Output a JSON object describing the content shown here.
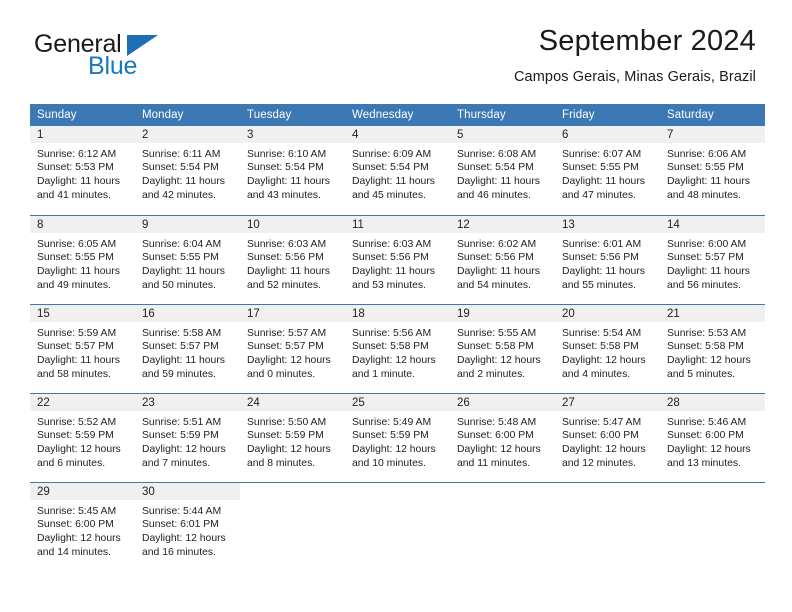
{
  "brand": {
    "name_part1": "General",
    "name_part2": "Blue",
    "color_dark": "#1a1a1a",
    "color_blue": "#1878be"
  },
  "header": {
    "title": "September 2024",
    "subtitle": "Campos Gerais, Minas Gerais, Brazil"
  },
  "theme": {
    "header_blue": "#3c78b4",
    "daynum_gray": "#f0f0f0",
    "text": "#222222"
  },
  "calendar": {
    "weekday_headers": [
      "Sunday",
      "Monday",
      "Tuesday",
      "Wednesday",
      "Thursday",
      "Friday",
      "Saturday"
    ],
    "weeks": [
      [
        {
          "day": "1",
          "sunrise": "Sunrise: 6:12 AM",
          "sunset": "Sunset: 5:53 PM",
          "daylight_line1": "Daylight: 11 hours",
          "daylight_line2": "and 41 minutes."
        },
        {
          "day": "2",
          "sunrise": "Sunrise: 6:11 AM",
          "sunset": "Sunset: 5:54 PM",
          "daylight_line1": "Daylight: 11 hours",
          "daylight_line2": "and 42 minutes."
        },
        {
          "day": "3",
          "sunrise": "Sunrise: 6:10 AM",
          "sunset": "Sunset: 5:54 PM",
          "daylight_line1": "Daylight: 11 hours",
          "daylight_line2": "and 43 minutes."
        },
        {
          "day": "4",
          "sunrise": "Sunrise: 6:09 AM",
          "sunset": "Sunset: 5:54 PM",
          "daylight_line1": "Daylight: 11 hours",
          "daylight_line2": "and 45 minutes."
        },
        {
          "day": "5",
          "sunrise": "Sunrise: 6:08 AM",
          "sunset": "Sunset: 5:54 PM",
          "daylight_line1": "Daylight: 11 hours",
          "daylight_line2": "and 46 minutes."
        },
        {
          "day": "6",
          "sunrise": "Sunrise: 6:07 AM",
          "sunset": "Sunset: 5:55 PM",
          "daylight_line1": "Daylight: 11 hours",
          "daylight_line2": "and 47 minutes."
        },
        {
          "day": "7",
          "sunrise": "Sunrise: 6:06 AM",
          "sunset": "Sunset: 5:55 PM",
          "daylight_line1": "Daylight: 11 hours",
          "daylight_line2": "and 48 minutes."
        }
      ],
      [
        {
          "day": "8",
          "sunrise": "Sunrise: 6:05 AM",
          "sunset": "Sunset: 5:55 PM",
          "daylight_line1": "Daylight: 11 hours",
          "daylight_line2": "and 49 minutes."
        },
        {
          "day": "9",
          "sunrise": "Sunrise: 6:04 AM",
          "sunset": "Sunset: 5:55 PM",
          "daylight_line1": "Daylight: 11 hours",
          "daylight_line2": "and 50 minutes."
        },
        {
          "day": "10",
          "sunrise": "Sunrise: 6:03 AM",
          "sunset": "Sunset: 5:56 PM",
          "daylight_line1": "Daylight: 11 hours",
          "daylight_line2": "and 52 minutes."
        },
        {
          "day": "11",
          "sunrise": "Sunrise: 6:03 AM",
          "sunset": "Sunset: 5:56 PM",
          "daylight_line1": "Daylight: 11 hours",
          "daylight_line2": "and 53 minutes."
        },
        {
          "day": "12",
          "sunrise": "Sunrise: 6:02 AM",
          "sunset": "Sunset: 5:56 PM",
          "daylight_line1": "Daylight: 11 hours",
          "daylight_line2": "and 54 minutes."
        },
        {
          "day": "13",
          "sunrise": "Sunrise: 6:01 AM",
          "sunset": "Sunset: 5:56 PM",
          "daylight_line1": "Daylight: 11 hours",
          "daylight_line2": "and 55 minutes."
        },
        {
          "day": "14",
          "sunrise": "Sunrise: 6:00 AM",
          "sunset": "Sunset: 5:57 PM",
          "daylight_line1": "Daylight: 11 hours",
          "daylight_line2": "and 56 minutes."
        }
      ],
      [
        {
          "day": "15",
          "sunrise": "Sunrise: 5:59 AM",
          "sunset": "Sunset: 5:57 PM",
          "daylight_line1": "Daylight: 11 hours",
          "daylight_line2": "and 58 minutes."
        },
        {
          "day": "16",
          "sunrise": "Sunrise: 5:58 AM",
          "sunset": "Sunset: 5:57 PM",
          "daylight_line1": "Daylight: 11 hours",
          "daylight_line2": "and 59 minutes."
        },
        {
          "day": "17",
          "sunrise": "Sunrise: 5:57 AM",
          "sunset": "Sunset: 5:57 PM",
          "daylight_line1": "Daylight: 12 hours",
          "daylight_line2": "and 0 minutes."
        },
        {
          "day": "18",
          "sunrise": "Sunrise: 5:56 AM",
          "sunset": "Sunset: 5:58 PM",
          "daylight_line1": "Daylight: 12 hours",
          "daylight_line2": "and 1 minute."
        },
        {
          "day": "19",
          "sunrise": "Sunrise: 5:55 AM",
          "sunset": "Sunset: 5:58 PM",
          "daylight_line1": "Daylight: 12 hours",
          "daylight_line2": "and 2 minutes."
        },
        {
          "day": "20",
          "sunrise": "Sunrise: 5:54 AM",
          "sunset": "Sunset: 5:58 PM",
          "daylight_line1": "Daylight: 12 hours",
          "daylight_line2": "and 4 minutes."
        },
        {
          "day": "21",
          "sunrise": "Sunrise: 5:53 AM",
          "sunset": "Sunset: 5:58 PM",
          "daylight_line1": "Daylight: 12 hours",
          "daylight_line2": "and 5 minutes."
        }
      ],
      [
        {
          "day": "22",
          "sunrise": "Sunrise: 5:52 AM",
          "sunset": "Sunset: 5:59 PM",
          "daylight_line1": "Daylight: 12 hours",
          "daylight_line2": "and 6 minutes."
        },
        {
          "day": "23",
          "sunrise": "Sunrise: 5:51 AM",
          "sunset": "Sunset: 5:59 PM",
          "daylight_line1": "Daylight: 12 hours",
          "daylight_line2": "and 7 minutes."
        },
        {
          "day": "24",
          "sunrise": "Sunrise: 5:50 AM",
          "sunset": "Sunset: 5:59 PM",
          "daylight_line1": "Daylight: 12 hours",
          "daylight_line2": "and 8 minutes."
        },
        {
          "day": "25",
          "sunrise": "Sunrise: 5:49 AM",
          "sunset": "Sunset: 5:59 PM",
          "daylight_line1": "Daylight: 12 hours",
          "daylight_line2": "and 10 minutes."
        },
        {
          "day": "26",
          "sunrise": "Sunrise: 5:48 AM",
          "sunset": "Sunset: 6:00 PM",
          "daylight_line1": "Daylight: 12 hours",
          "daylight_line2": "and 11 minutes."
        },
        {
          "day": "27",
          "sunrise": "Sunrise: 5:47 AM",
          "sunset": "Sunset: 6:00 PM",
          "daylight_line1": "Daylight: 12 hours",
          "daylight_line2": "and 12 minutes."
        },
        {
          "day": "28",
          "sunrise": "Sunrise: 5:46 AM",
          "sunset": "Sunset: 6:00 PM",
          "daylight_line1": "Daylight: 12 hours",
          "daylight_line2": "and 13 minutes."
        }
      ],
      [
        {
          "day": "29",
          "sunrise": "Sunrise: 5:45 AM",
          "sunset": "Sunset: 6:00 PM",
          "daylight_line1": "Daylight: 12 hours",
          "daylight_line2": "and 14 minutes."
        },
        {
          "day": "30",
          "sunrise": "Sunrise: 5:44 AM",
          "sunset": "Sunset: 6:01 PM",
          "daylight_line1": "Daylight: 12 hours",
          "daylight_line2": "and 16 minutes."
        },
        {
          "day": "",
          "sunrise": "",
          "sunset": "",
          "daylight_line1": "",
          "daylight_line2": ""
        },
        {
          "day": "",
          "sunrise": "",
          "sunset": "",
          "daylight_line1": "",
          "daylight_line2": ""
        },
        {
          "day": "",
          "sunrise": "",
          "sunset": "",
          "daylight_line1": "",
          "daylight_line2": ""
        },
        {
          "day": "",
          "sunrise": "",
          "sunset": "",
          "daylight_line1": "",
          "daylight_line2": ""
        },
        {
          "day": "",
          "sunrise": "",
          "sunset": "",
          "daylight_line1": "",
          "daylight_line2": ""
        }
      ]
    ]
  }
}
